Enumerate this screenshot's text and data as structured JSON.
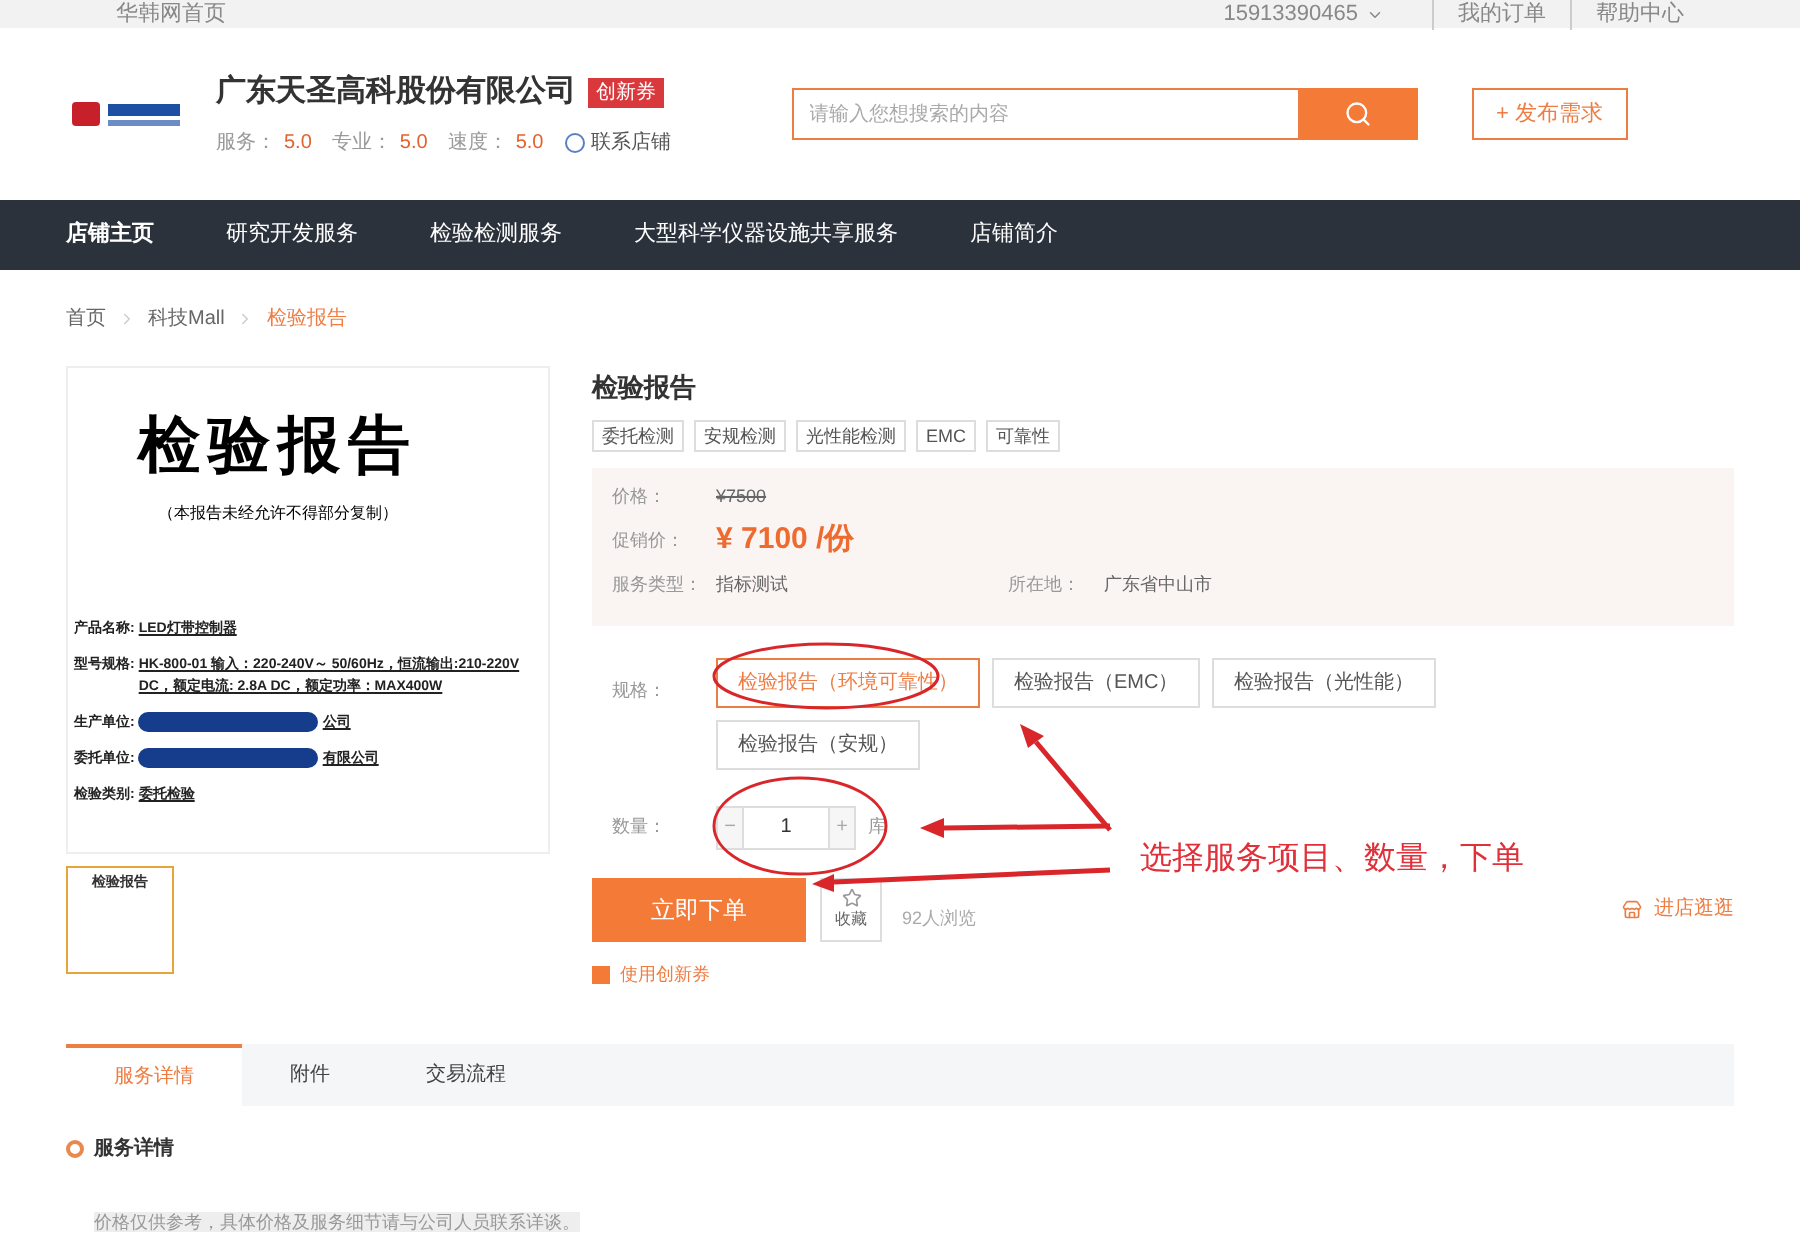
{
  "top_bar": {
    "home_link": "华韩网首页",
    "phone": "15913390465",
    "links": [
      "我的订单",
      "帮助中心"
    ]
  },
  "shop": {
    "name": "广东天圣高科股份有限公司",
    "badge": "创新券",
    "ratings": [
      {
        "label": "服务：",
        "value": "5.0"
      },
      {
        "label": "专业：",
        "value": "5.0"
      },
      {
        "label": "速度：",
        "value": "5.0"
      }
    ],
    "contact": "联系店铺"
  },
  "search": {
    "placeholder": "请输入您想搜索的内容"
  },
  "publish_button": "+ 发布需求",
  "nav": [
    {
      "label": "店铺主页",
      "selected": true
    },
    {
      "label": "研究开发服务",
      "selected": false
    },
    {
      "label": "检验检测服务",
      "selected": false
    },
    {
      "label": "大型科学仪器设施共享服务",
      "selected": false
    },
    {
      "label": "店铺简介",
      "selected": false
    }
  ],
  "breadcrumb": [
    {
      "label": "首页",
      "current": false
    },
    {
      "label": "科技Mall",
      "current": false
    },
    {
      "label": "检验报告",
      "current": true
    }
  ],
  "document": {
    "title": "检验报告",
    "subtitle": "（本报告未经允许不得部分复制）",
    "lines": [
      {
        "label": "产品名称:",
        "value": "LED灯带控制器"
      },
      {
        "label": "型号规格:",
        "value": "HK-800-01 输入：220-240V～ 50/60Hz，恒流输出:210-220V DC，额定电流: 2.8A DC，额定功率：MAX400W"
      },
      {
        "label": "生产单位:",
        "value": "公司",
        "redacted": true
      },
      {
        "label": "委托单位:",
        "value": "有限公司",
        "redacted": true
      },
      {
        "label": "检验类别:",
        "value": "委托检验"
      }
    ]
  },
  "thumbnails": [
    {
      "title": "检验报告",
      "selected": true
    }
  ],
  "product": {
    "title": "检验报告",
    "tags": [
      "委托检测",
      "安规检测",
      "光性能检测",
      "EMC",
      "可靠性"
    ],
    "price_label": "价格：",
    "price": "¥7500",
    "promo_label": "促销价：",
    "promo_price": "¥ 7100 /份",
    "type_label": "服务类型：",
    "type": "指标测试",
    "location_label": "所在地：",
    "location": "广东省中山市"
  },
  "spec": {
    "label": "规格：",
    "options": [
      {
        "label": "检验报告（环境可靠性）",
        "selected": true
      },
      {
        "label": "检验报告（EMC）",
        "selected": false
      },
      {
        "label": "检验报告（光性能）",
        "selected": false
      },
      {
        "label": "检验报告（安规）",
        "selected": false
      }
    ]
  },
  "quantity": {
    "label": "数量：",
    "minus": "−",
    "value": "1",
    "plus": "+",
    "stock": "库"
  },
  "buy_button": "立即下单",
  "collect_button": "收藏",
  "views": "92人浏览",
  "shop_link": "进店逛逛",
  "coupon": {
    "label": "使用创新券",
    "checked": true
  },
  "annotation": "选择服务项目、数量，下单",
  "tabs": [
    {
      "label": "服务详情",
      "selected": true
    },
    {
      "label": "附件",
      "selected": false
    },
    {
      "label": "交易流程",
      "selected": false
    }
  ],
  "section": {
    "title": "服务详情",
    "note": "价格仅供参考，具体价格及服务细节请与公司人员联系详谈。"
  }
}
